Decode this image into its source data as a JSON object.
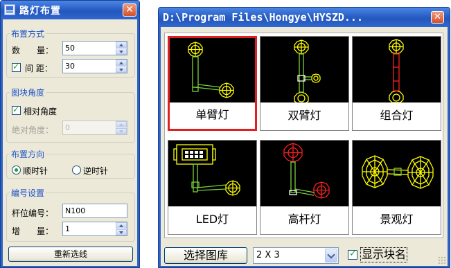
{
  "dialog": {
    "title": "路灯布置",
    "close_glyph": "✕",
    "layout_group": {
      "title": "布置方式",
      "count_label": "数　　量：",
      "count_value": "50",
      "spacing_label": "间 距：",
      "spacing_value": "30",
      "spacing_checked": true
    },
    "angle_group": {
      "title": "图块角度",
      "relative_label": "相对角度",
      "relative_checked": true,
      "absolute_label": "绝对角度：",
      "absolute_value": "0"
    },
    "direction_group": {
      "title": "布置方向",
      "clockwise_label": "顺时针",
      "counter_label": "逆时针",
      "selected": "顺时针"
    },
    "numbering_group": {
      "title": "编号设置",
      "pole_label": "杆位编号：",
      "pole_value": "N100",
      "increment_label": "增　　量：",
      "increment_value": "1"
    },
    "reselect_button": "重新选线"
  },
  "chooser": {
    "title": "D:\\Program Files\\Hongye\\HYSZD...",
    "close_glyph": "✕",
    "tiles": [
      {
        "label": "单臂灯",
        "selected": true
      },
      {
        "label": "双臂灯",
        "selected": false
      },
      {
        "label": "组合灯",
        "selected": false
      },
      {
        "label": "LED灯",
        "selected": false
      },
      {
        "label": "高杆灯",
        "selected": false
      },
      {
        "label": "景观灯",
        "selected": false
      }
    ],
    "select_library_button": "选择图库",
    "grid_combo_value": "2 X 3",
    "show_block_name_label": "显示块名",
    "show_block_name_checked": true
  },
  "colors": {
    "titlebar_blue": "#2457bd",
    "dialog_face": "#ece9d8",
    "group_title": "#1d52c8",
    "selection_red": "#e02020",
    "symbol_yellow": "#ffff00",
    "symbol_green": "#7cd13a",
    "symbol_red": "#ff2020"
  }
}
